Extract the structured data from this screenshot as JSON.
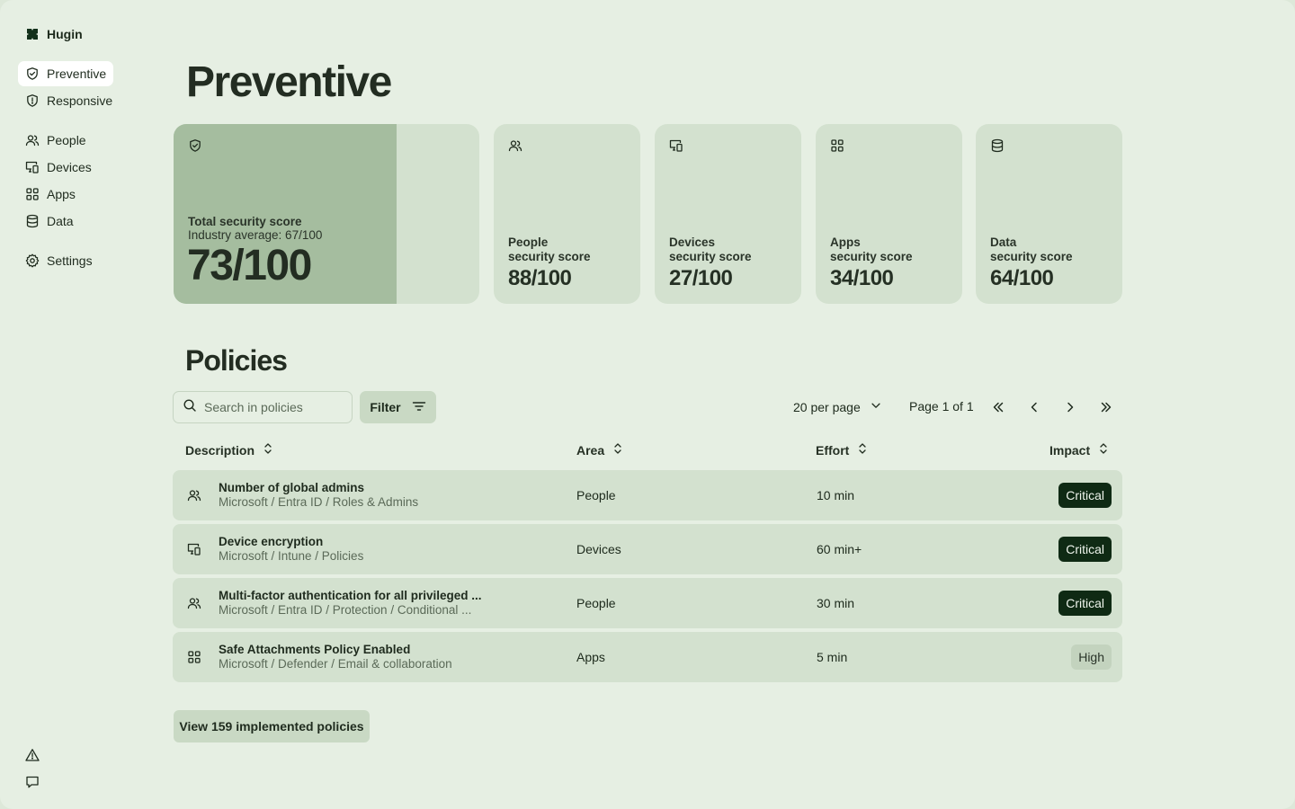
{
  "brand": {
    "name": "Hugin",
    "icon": "hugin-logo"
  },
  "sidebar": {
    "items": [
      {
        "label": "Preventive",
        "icon": "shield-check-icon",
        "active": true
      },
      {
        "label": "Responsive",
        "icon": "shield-alert-icon",
        "active": false
      },
      {
        "label": "People",
        "icon": "users-icon",
        "active": false
      },
      {
        "label": "Devices",
        "icon": "devices-icon",
        "active": false
      },
      {
        "label": "Apps",
        "icon": "grid-icon",
        "active": false
      },
      {
        "label": "Data",
        "icon": "database-icon",
        "active": false
      },
      {
        "label": "Settings",
        "icon": "gear-icon",
        "active": false
      }
    ],
    "bottom_icons": [
      "warning-icon",
      "chat-icon"
    ]
  },
  "page": {
    "title": "Preventive"
  },
  "scores": {
    "total": {
      "label": "Total security score",
      "industry": "Industry average: 67/100",
      "value": "73/100",
      "fraction": 0.73
    },
    "cards": [
      {
        "title": "People",
        "subtitle": "security score",
        "value": "88/100",
        "icon": "users-icon"
      },
      {
        "title": "Devices",
        "subtitle": "security score",
        "value": "27/100",
        "icon": "devices-icon"
      },
      {
        "title": "Apps",
        "subtitle": "security score",
        "value": "34/100",
        "icon": "grid-icon"
      },
      {
        "title": "Data",
        "subtitle": "security score",
        "value": "64/100",
        "icon": "database-icon"
      }
    ]
  },
  "policies": {
    "title": "Policies",
    "search_placeholder": "Search in policies",
    "filter_label": "Filter",
    "per_page": "20 per page",
    "page_info": "Page 1 of 1",
    "columns": [
      "Description",
      "Area",
      "Effort",
      "Impact"
    ],
    "rows": [
      {
        "title": "Number of global admins",
        "path": "Microsoft / Entra ID / Roles & Admins",
        "area": "People",
        "effort": "10 min",
        "impact": "Critical",
        "icon": "users-icon"
      },
      {
        "title": "Device encryption",
        "path": "Microsoft / Intune / Policies",
        "area": "Devices",
        "effort": "60 min+",
        "impact": "Critical",
        "icon": "devices-icon"
      },
      {
        "title": "Multi-factor authentication for all privileged ...",
        "path": "Microsoft / Entra ID / Protection / Conditional ...",
        "area": "People",
        "effort": "30 min",
        "impact": "Critical",
        "icon": "users-icon"
      },
      {
        "title": "Safe Attachments Policy Enabled",
        "path": "Microsoft / Defender / Email & collaboration",
        "area": "Apps",
        "effort": "5 min",
        "impact": "High",
        "icon": "grid-icon"
      }
    ],
    "view_implemented": "View 159 implemented policies"
  },
  "colors": {
    "background": "#e6efe3",
    "card": "#d3e1cf",
    "score_fill": "#a5bd9f",
    "critical_badge": "#0f2a14",
    "high_badge": "#c3d3be"
  }
}
